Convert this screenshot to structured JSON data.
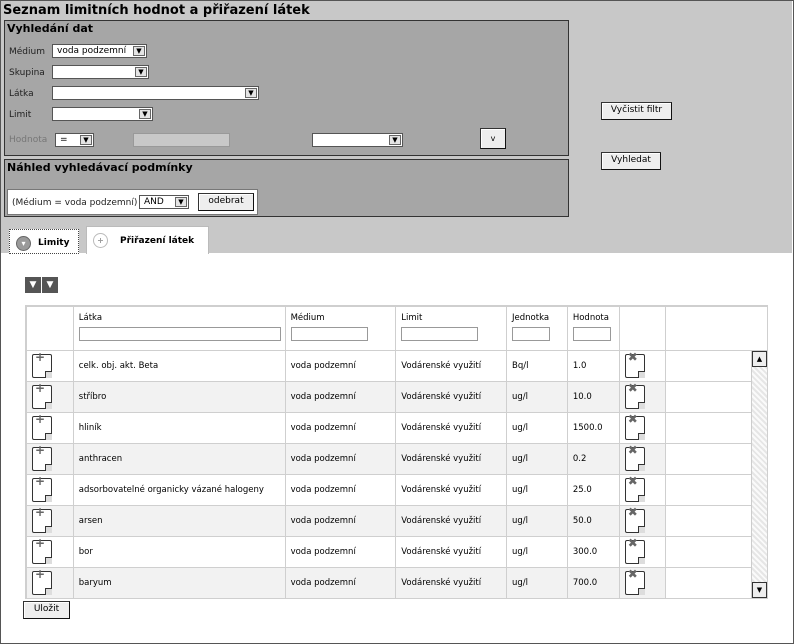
{
  "title": "Seznam limitních hodnot a přiřazení látek",
  "search_panel": {
    "title": "Vyhledání dat",
    "medium_label": "Médium",
    "medium_value": "voda podzemní",
    "group_label": "Skupina",
    "group_value": "",
    "substance_label": "Látka",
    "substance_value": "",
    "limit_label": "Limit",
    "limit_value": "",
    "value_label": "Hodnota",
    "operator_value": "=",
    "value_input": "",
    "value_select": "",
    "small_button": "v"
  },
  "preview_panel": {
    "title": "Náhled vyhledávací podmínky",
    "condition": "(Médium = voda podzemní)",
    "logic_value": "AND",
    "remove_label": "odebrat"
  },
  "buttons": {
    "clear_filter": "Vyčistit filtr",
    "search": "Vyhledat",
    "save": "Uložit"
  },
  "tabs": [
    {
      "label": "Limity",
      "active": true
    },
    {
      "label": "Přiřazení látek",
      "active": false
    }
  ],
  "table": {
    "columns": [
      "",
      "Látka",
      "Médium",
      "Limit",
      "Jednotka",
      "Hodnota",
      ""
    ],
    "rows": [
      {
        "substance": "celk. obj. akt. Beta",
        "medium": "voda podzemní",
        "limit": "Vodárenské využití",
        "unit": "Bq/l",
        "value": "1.0"
      },
      {
        "substance": "stříbro",
        "medium": "voda podzemní",
        "limit": "Vodárenské využití",
        "unit": "ug/l",
        "value": "10.0"
      },
      {
        "substance": "hliník",
        "medium": "voda podzemní",
        "limit": "Vodárenské využití",
        "unit": "ug/l",
        "value": "1500.0"
      },
      {
        "substance": "anthracen",
        "medium": "voda podzemní",
        "limit": "Vodárenské využití",
        "unit": "ug/l",
        "value": "0.2"
      },
      {
        "substance": "adsorbovatelné organicky vázané halogeny",
        "medium": "voda podzemní",
        "limit": "Vodárenské využití",
        "unit": "ug/l",
        "value": "25.0"
      },
      {
        "substance": "arsen",
        "medium": "voda podzemní",
        "limit": "Vodárenské využití",
        "unit": "ug/l",
        "value": "50.0"
      },
      {
        "substance": "bor",
        "medium": "voda podzemní",
        "limit": "Vodárenské využití",
        "unit": "ug/l",
        "value": "300.0"
      },
      {
        "substance": "baryum",
        "medium": "voda podzemní",
        "limit": "Vodárenské využití",
        "unit": "ug/l",
        "value": "700.0"
      }
    ]
  },
  "icons": {
    "edit": "edit-document-icon",
    "delete": "delete-document-icon",
    "filter": "filter-icon",
    "tab_active": "minus-circle-icon",
    "tab_inactive": "plus-circle-icon"
  }
}
